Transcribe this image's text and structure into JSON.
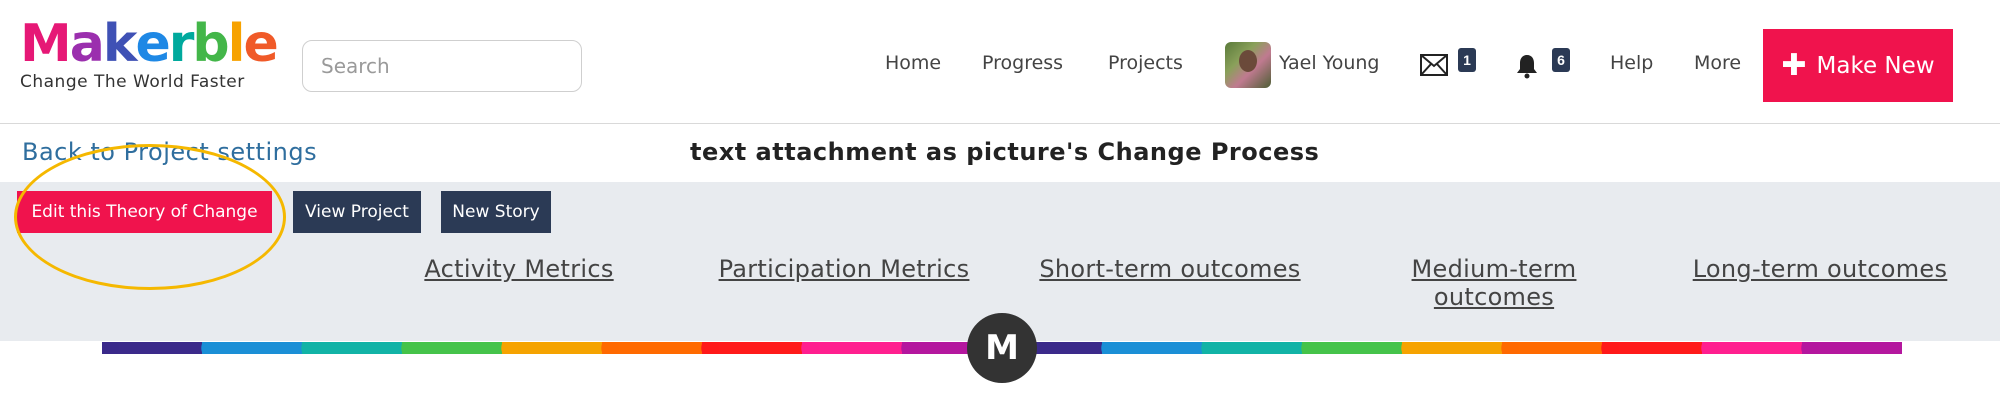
{
  "brand": {
    "letters": [
      {
        "ch": "M",
        "color": "#e61876"
      },
      {
        "ch": "a",
        "color": "#9b2fae"
      },
      {
        "ch": "k",
        "color": "#3f51b5"
      },
      {
        "ch": "e",
        "color": "#1e88e5"
      },
      {
        "ch": "r",
        "color": "#00a99d"
      },
      {
        "ch": "b",
        "color": "#43b649"
      },
      {
        "ch": "l",
        "color": "#f7a200"
      },
      {
        "ch": "e",
        "color": "#f05a28"
      }
    ],
    "tagline": "Change The World Faster"
  },
  "search": {
    "placeholder": "Search"
  },
  "nav": {
    "home": "Home",
    "progress": "Progress",
    "projects": "Projects",
    "user_name": "Yael Young",
    "messages_count": "1",
    "notifications_count": "6",
    "help": "Help",
    "more": "More",
    "make_new": "Make New"
  },
  "subheader": {
    "back_link": "Back to Project settings",
    "title": "text attachment as picture's Change Process"
  },
  "actions": {
    "edit": "Edit this Theory of Change",
    "view": "View Project",
    "new_story": "New Story"
  },
  "columns": {
    "activity": "Activity Metrics",
    "participation": "Participation Metrics",
    "short_term": "Short-term outcomes",
    "medium_term_1": "Medium-term",
    "medium_term_2": "outcomes",
    "long_term": "Long-term outcomes"
  },
  "center_marker": "M",
  "colors": {
    "accent": "#f0134d",
    "navy": "#2b3a55",
    "link_blue": "#2f6e9e",
    "highlight": "#f5b800",
    "bar_segments": [
      "#3b2a8a",
      "#1b8fd6",
      "#12b3a6",
      "#45c34a",
      "#f5a300",
      "#ff6a00",
      "#ff1a1a",
      "#ff1f8f",
      "#b4179e"
    ]
  }
}
